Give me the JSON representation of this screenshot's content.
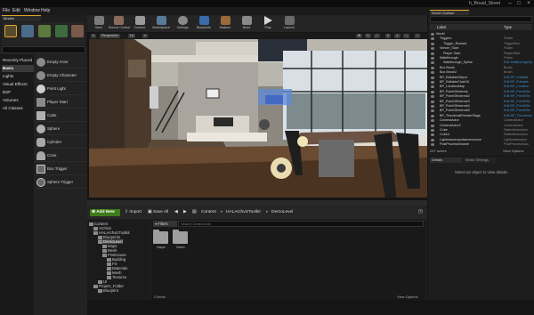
{
  "window": {
    "title": "h_Broad_Street"
  },
  "menu": [
    "File",
    "Edit",
    "Window",
    "Help"
  ],
  "modes": {
    "tab": "Modes",
    "categories": [
      "Recently Placed",
      "Basic",
      "Lights",
      "Visual Effects",
      "BSP",
      "Volumes",
      "All Classes"
    ],
    "selected_category": "Basic",
    "items": [
      "Empty Actor",
      "Empty Character",
      "Point Light",
      "Player Start",
      "Cube",
      "Sphere",
      "Cylinder",
      "Cone",
      "Box Trigger",
      "Sphere Trigger"
    ]
  },
  "toolbar": [
    "Save",
    "Source Control",
    "Content",
    "Marketplace",
    "Settings",
    "Blueprints",
    "Matinee",
    "Build",
    "Play",
    "Launch"
  ],
  "viewport": {
    "perspective": "Perspective",
    "lit": "Lit"
  },
  "content_browser": {
    "add_new": "Add New",
    "import": "Import",
    "save_all": "Save All",
    "breadcrumb": [
      "Content",
      "HALArchvizToolkit",
      "DemoLevel"
    ],
    "filters": "Filters",
    "search_placeholder": "Search DemoLevel",
    "tree": [
      {
        "label": "Content",
        "depth": 0
      },
      {
        "label": "Archviz",
        "depth": 1
      },
      {
        "label": "HALArchvizToolkit",
        "depth": 1
      },
      {
        "label": "Blueprints",
        "depth": 2
      },
      {
        "label": "DemoLevel",
        "depth": 2,
        "selected": true
      },
      {
        "label": "Maps",
        "depth": 3
      },
      {
        "label": "Mesh",
        "depth": 3
      },
      {
        "label": "FirstHouse",
        "depth": 3
      },
      {
        "label": "Building",
        "depth": 4
      },
      {
        "label": "FX",
        "depth": 4
      },
      {
        "label": "Materials",
        "depth": 4
      },
      {
        "label": "Mesh",
        "depth": 4
      },
      {
        "label": "Textures",
        "depth": 4
      },
      {
        "label": "UI",
        "depth": 2
      },
      {
        "label": "Project_Folder",
        "depth": 1
      },
      {
        "label": "Blueprint",
        "depth": 2
      }
    ],
    "assets": [
      "Maps",
      "Mesh"
    ],
    "item_count": "2 items",
    "view_options": "View Options"
  },
  "outliner": {
    "tab": "World Outliner",
    "columns": {
      "label": "Label",
      "type": "Type"
    },
    "rows": [
      {
        "label": "World",
        "type": "",
        "depth": 0
      },
      {
        "label": "Triggers",
        "type": "Folder",
        "depth": 1
      },
      {
        "label": "Trigger_Rootset",
        "type": "TriggerBox",
        "depth": 2
      },
      {
        "label": "Viewer_Start",
        "type": "Folder",
        "depth": 1
      },
      {
        "label": "Player Start",
        "type": "PlayerStart",
        "depth": 2
      },
      {
        "label": "Walkthrough",
        "type": "Folder",
        "depth": 1
      },
      {
        "label": "Walkthrough_Spline",
        "type": "Edit WalkthroughSp",
        "depth": 2,
        "link": true
      },
      {
        "label": "Box Brush",
        "type": "Brush",
        "depth": 1
      },
      {
        "label": "Box Brush2",
        "type": "Brush",
        "depth": 1
      },
      {
        "label": "BP_EditableObject",
        "type": "Edit BP_Editable",
        "depth": 1,
        "link": true
      },
      {
        "label": "BP_EditableChair10",
        "type": "Edit BP_Editable",
        "depth": 1,
        "link": true
      },
      {
        "label": "BP_LocationMap",
        "type": "Edit BP_Location",
        "depth": 1,
        "link": true
      },
      {
        "label": "BP_PointOfInterest",
        "type": "Edit BP_PointOfIn",
        "depth": 1,
        "link": true
      },
      {
        "label": "BP_PointOfInterest2",
        "type": "Edit BP_PointOfIn",
        "depth": 1,
        "link": true
      },
      {
        "label": "BP_PointOfInterest3",
        "type": "Edit BP_PointOfIn",
        "depth": 1,
        "link": true
      },
      {
        "label": "BP_PointOfInterest4",
        "type": "Edit BP_PointOfIn",
        "depth": 1,
        "link": true
      },
      {
        "label": "BP_PointOfInterest5",
        "type": "Edit BP_PointOfIn",
        "depth": 1,
        "link": true
      },
      {
        "label": "BP_ThumbnailRenderStage",
        "type": "Edit BP_Thumbnail",
        "depth": 1,
        "link": true
      },
      {
        "label": "CameraActor",
        "type": "CameraActor",
        "depth": 1
      },
      {
        "label": "CameraActor2",
        "type": "CameraActor",
        "depth": 1
      },
      {
        "label": "Cube",
        "type": "StaticMeshActor",
        "depth": 1
      },
      {
        "label": "Cube4",
        "type": "StaticMeshActor",
        "depth": 1
      },
      {
        "label": "Lightmassimportancevolume",
        "type": "LightmassImpor",
        "depth": 1
      },
      {
        "label": "PostProcessVolume",
        "type": "PostProcessVolu",
        "depth": 1
      }
    ],
    "actor_count": "247 actors",
    "view_options": "View Options"
  },
  "details": {
    "tabs": [
      "Details",
      "World Settings"
    ],
    "message": "Select an object to view details."
  }
}
